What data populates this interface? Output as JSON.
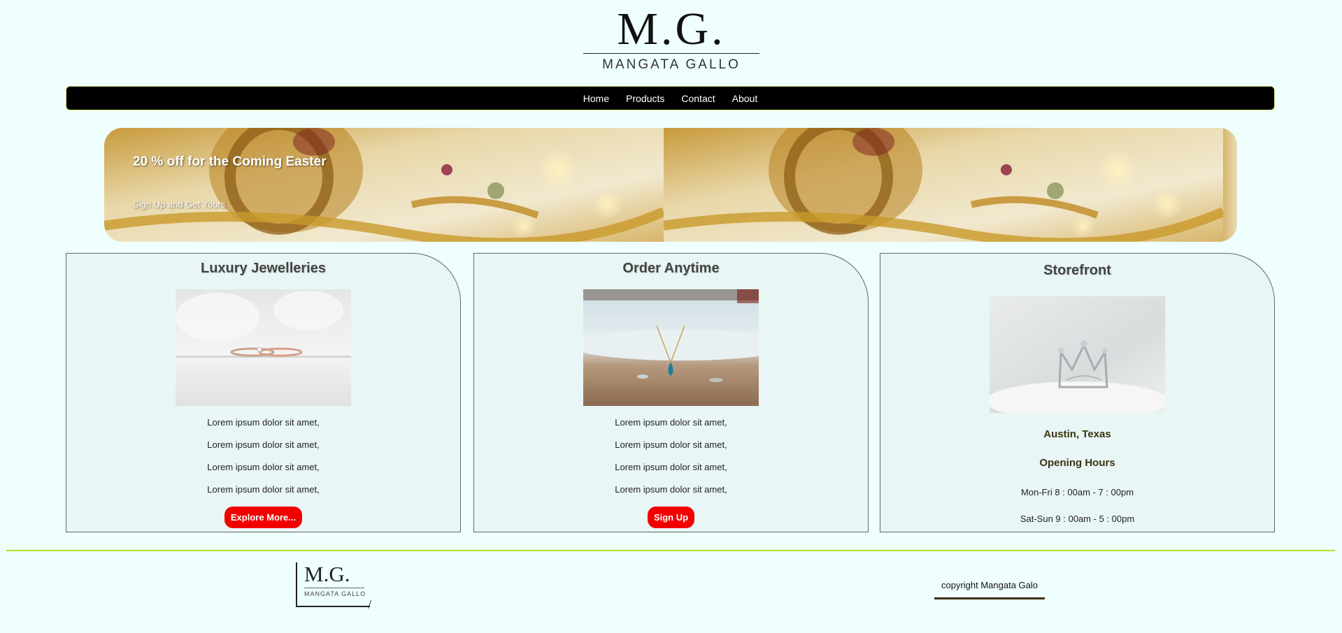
{
  "brand": {
    "logo_mark": "M.G.",
    "logo_name": "MANGATA GALLO",
    "footer_mark": "M.G.",
    "footer_name": "MANGATA GALLO"
  },
  "nav": {
    "items": [
      "Home",
      "Products",
      "Contact",
      "About"
    ]
  },
  "banner": {
    "title": "20 % off for the Coming Easter",
    "subtitle": "Sign Up and Get Yours"
  },
  "cards": [
    {
      "title": "Luxury Jewelleries",
      "lines": [
        "Lorem ipsum dolor sit amet,",
        "Lorem ipsum dolor sit amet,",
        "Lorem ipsum dolor sit amet,",
        "Lorem ipsum dolor sit amet,"
      ],
      "button": "Explore More..."
    },
    {
      "title": "Order Anytime",
      "lines": [
        "Lorem ipsum dolor sit amet,",
        "Lorem ipsum dolor sit amet,",
        "Lorem ipsum dolor sit amet,",
        "Lorem ipsum dolor sit amet,"
      ],
      "button": "Sign Up"
    },
    {
      "title": "Storefront",
      "location": "Austin, Texas",
      "hours_title": "Opening Hours",
      "hours": [
        "Mon-Fri 8 : 00am - 7 : 00pm",
        "Sat-Sun 9 : 00am - 5 : 00pm"
      ]
    }
  ],
  "footer": {
    "copyright": "copyright Mangata Galo"
  },
  "colors": {
    "background": "#effffe",
    "nav": "#000000",
    "accent_button": "#f20000",
    "footer_line": "#b3e02c"
  }
}
